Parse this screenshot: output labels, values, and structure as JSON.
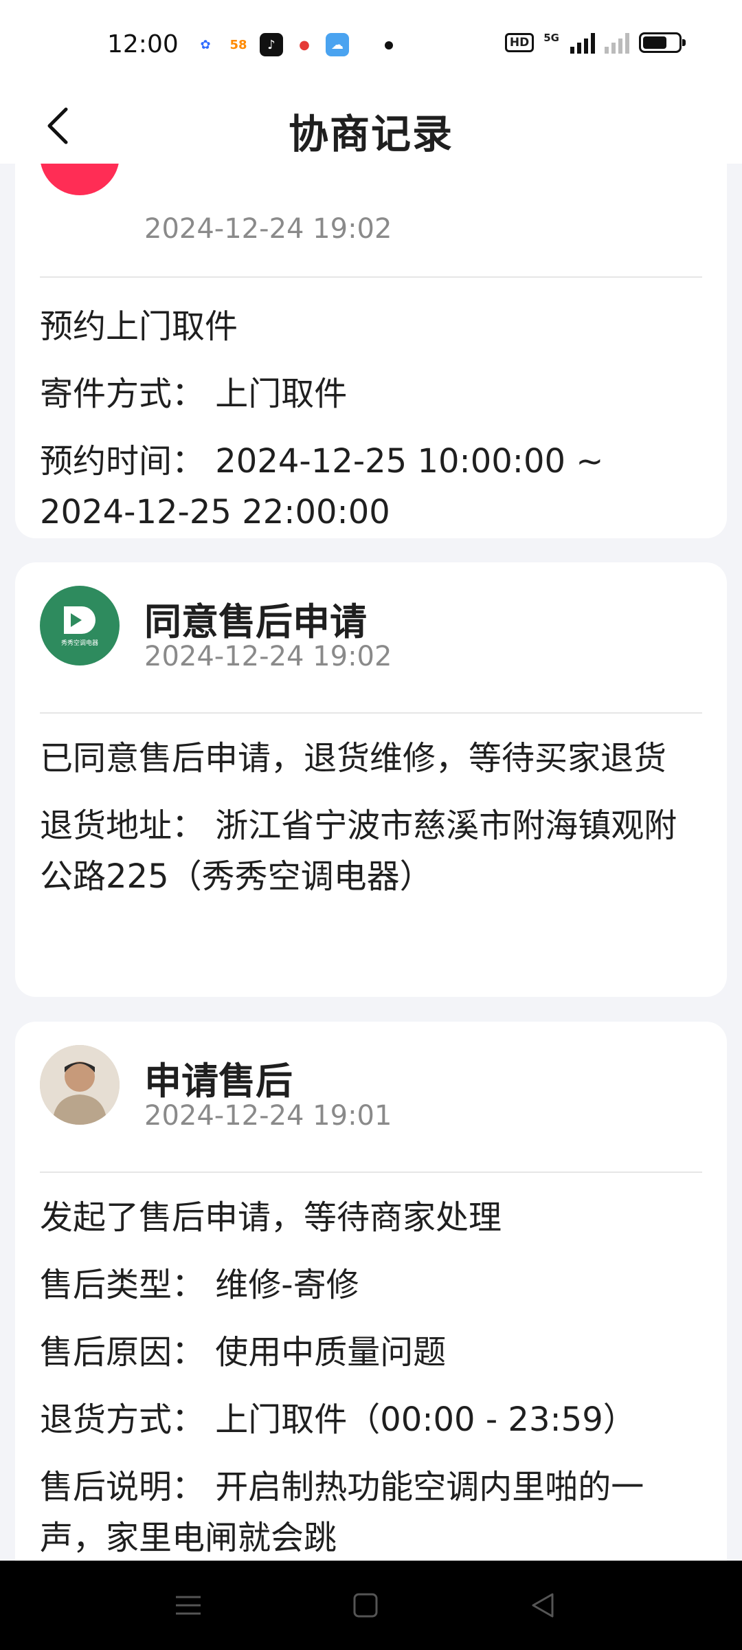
{
  "status_bar": {
    "time": "12:00",
    "apps": [
      {
        "icon": "baidu-icon",
        "text": "",
        "color": "#e8f0ff"
      },
      {
        "icon": "58-icon",
        "text": "58",
        "color": "#ffffff"
      },
      {
        "icon": "tiktok-icon",
        "text": "",
        "color": "#111111"
      },
      {
        "icon": "video-icon",
        "text": "",
        "color": "#e53935"
      },
      {
        "icon": "weather-icon",
        "text": "",
        "color": "#4aa3f0"
      }
    ],
    "hd": "HD",
    "network": "5G"
  },
  "header": {
    "title": "协商记录"
  },
  "cards": [
    {
      "title": "",
      "time": "2024-12-24 19:02",
      "avatar_color": "#ff2d55",
      "lines": [
        "预约上门取件",
        "寄件方式：  上门取件",
        "预约时间：  2024-12-25 10:00:00 ~ 2024-12-25 22:00:00"
      ]
    },
    {
      "title": "同意售后申请",
      "time": "2024-12-24 19:02",
      "avatar_color": "#2e8b5e",
      "lines": [
        "已同意售后申请，退货维修，等待买家退货",
        "退货地址：  浙江省宁波市慈溪市附海镇观附公路225（秀秀空调电器）"
      ]
    },
    {
      "title": "申请售后",
      "time": "2024-12-24 19:01",
      "avatar_color": "#c9b8a6",
      "lines": [
        "发起了售后申请，等待商家处理",
        "售后类型：  维修-寄修",
        "售后原因：  使用中质量问题",
        "退货方式：  上门取件（00:00 - 23:59）",
        "售后说明：  开启制热功能空调内里啪的一声，家里电闸就会跳"
      ]
    }
  ],
  "colors": {
    "background": "#f3f4f8",
    "card": "#ffffff",
    "time_text": "#8a8a8a"
  }
}
